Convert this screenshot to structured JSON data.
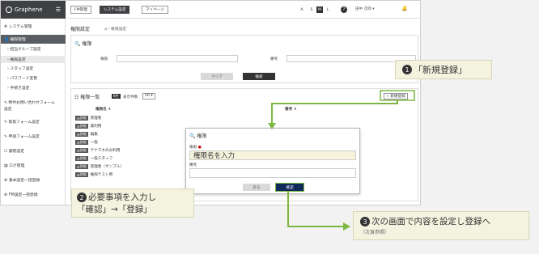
{
  "topbar": {
    "brand": "Graphene",
    "buttons": [
      "FM管理",
      "システム設定",
      "マイページ"
    ],
    "text_sizes": [
      "A",
      "S",
      "M",
      "L"
    ],
    "text_size_selected": "M",
    "help": "?",
    "user": "田中 次郎 ▾"
  },
  "sidebar": {
    "items": [
      {
        "label": "システム管理",
        "icon": "gear-icon"
      },
      {
        "label": "権限管理",
        "icon": "user-icon"
      },
      {
        "label": "› 担当グループ設定"
      },
      {
        "label": "› 権限設定"
      },
      {
        "label": "› スタッフ設定"
      },
      {
        "label": "› パスワード変更"
      },
      {
        "label": "› 手続き設定"
      },
      {
        "label": "物件お問い合わせフォーム"
      },
      {
        "label": "設定"
      },
      {
        "label": "取扱フォーム設定"
      },
      {
        "label": "申請フォーム設定"
      },
      {
        "label": "顧客設定"
      },
      {
        "label": "ログ管理"
      },
      {
        "label": "基本設定一括登録"
      },
      {
        "label": "FM設定一括登録"
      }
    ]
  },
  "breadcrumb": {
    "title": "権限設定",
    "path": "権限設定"
  },
  "search": {
    "title": "権限",
    "label_name": "権限",
    "label_note": "備考",
    "clear": "クリア",
    "search": "検索"
  },
  "list": {
    "title": "権限一覧",
    "count": "8件",
    "per_page_label": "表示件数",
    "per_page": "50",
    "new_btn": "+ 新規登録",
    "col_name": "権限名 ⇕",
    "col_note": "備考 ⇕",
    "edit_label": "詳細",
    "rows": [
      "管理者",
      "賃利用",
      "編集",
      "一般",
      "テナマネのみ利用",
      "一般スタッフ",
      "管理者（サンプル）",
      "権限テスト用"
    ]
  },
  "modal": {
    "title": "権限",
    "name_label": "権限",
    "name_placeholder": "権限名を入力",
    "note_label": "備考",
    "back": "戻る",
    "confirm": "確認"
  },
  "callouts": {
    "c1_num": "1",
    "c1": "「新規登録」",
    "c2_num": "2",
    "c2_line1": "必要事項を入力し",
    "c2_line2": "「確認」→「登録」",
    "c3_num": "3",
    "c3": "次の画面で内容を設定し登録へ",
    "c3_note": "（次頁参照）"
  },
  "colors": {
    "arrow": "#7cb742",
    "sidebar_dark": "#3e4043",
    "navy_button": "#10295b"
  }
}
